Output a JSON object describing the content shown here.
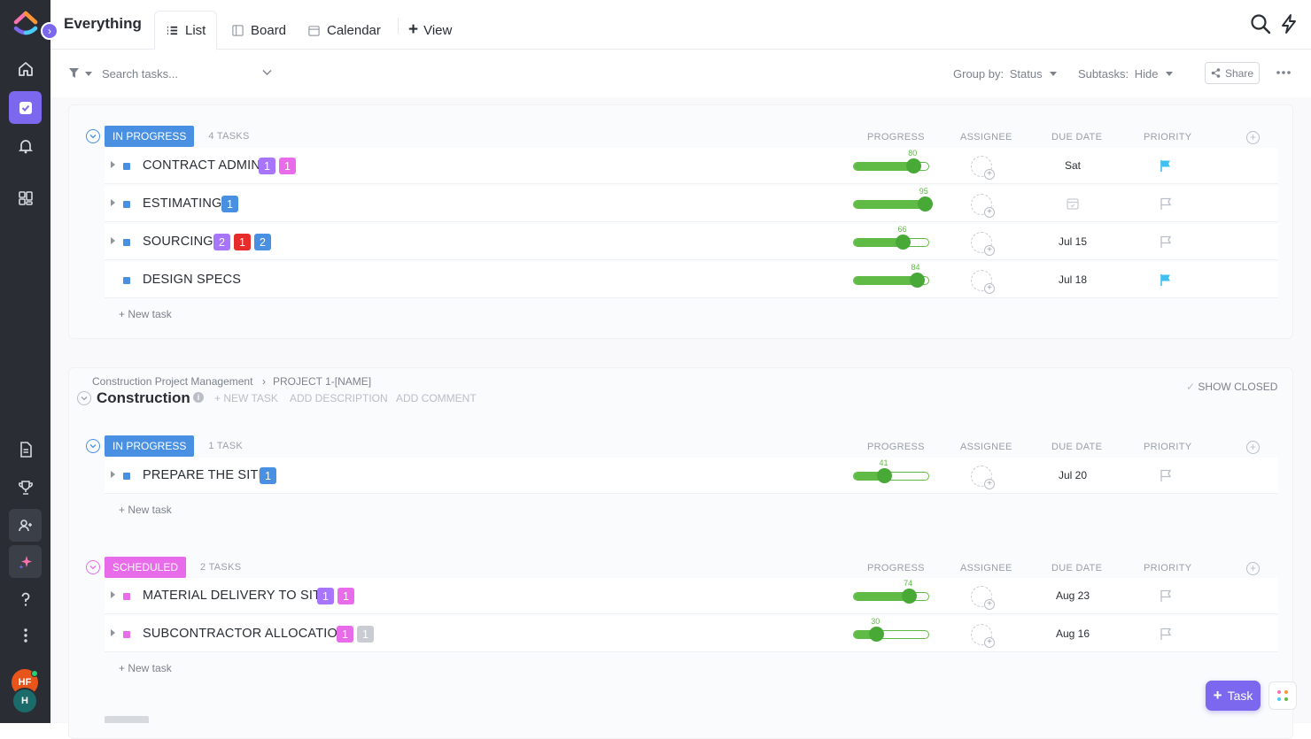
{
  "header": {
    "title": "Everything",
    "tabs": [
      {
        "label": "List"
      },
      {
        "label": "Board"
      },
      {
        "label": "Calendar"
      }
    ],
    "view_label": "View"
  },
  "toolbar": {
    "search_placeholder": "Search tasks...",
    "group_by_label": "Group by:",
    "group_by_value": "Status",
    "subtasks_label": "Subtasks:",
    "subtasks_value": "Hide",
    "share_label": "Share"
  },
  "columns": {
    "progress": "PROGRESS",
    "assignee": "ASSIGNEE",
    "due_date": "DUE DATE",
    "priority": "PRIORITY"
  },
  "new_task_label": "+ New task",
  "groups": [
    {
      "status": "IN PROGRESS",
      "status_color": "#4a90e2",
      "count": "4 TASKS",
      "tasks": [
        {
          "name": "CONTRACT ADMIN",
          "tags": [
            "1",
            "1"
          ],
          "progress": 80,
          "due": "Sat",
          "priority": "flagged"
        },
        {
          "name": "ESTIMATING",
          "tags": [
            "1"
          ],
          "progress": 95,
          "due": "",
          "priority": "none"
        },
        {
          "name": "SOURCING",
          "tags": [
            "2",
            "1",
            "2"
          ],
          "progress": 66,
          "due": "Jul 15",
          "priority": "none"
        },
        {
          "name": "DESIGN SPECS",
          "tags": [],
          "progress": 84,
          "due": "Jul 18",
          "priority": "flagged"
        }
      ]
    },
    {
      "status": "IN PROGRESS",
      "status_color": "#4a90e2",
      "count": "1 TASK",
      "tasks": [
        {
          "name": "PREPARE THE SITE",
          "tags": [
            "1"
          ],
          "progress": 41,
          "due": "Jul 20",
          "priority": "none"
        }
      ]
    },
    {
      "status": "SCHEDULED",
      "status_color": "#e86ce9",
      "count": "2 TASKS",
      "tasks": [
        {
          "name": "MATERIAL DELIVERY TO SITE",
          "tags": [
            "1",
            "1"
          ],
          "progress": 74,
          "due": "Aug 23",
          "priority": "none"
        },
        {
          "name": "SUBCONTRACTOR ALLOCATION",
          "tags": [
            "1",
            "1"
          ],
          "progress": 30,
          "due": "Aug 16",
          "priority": "none"
        }
      ]
    }
  ],
  "list": {
    "breadcrumb_space": "Construction Project Management",
    "breadcrumb_folder": "PROJECT 1-[NAME]",
    "name": "Construction",
    "new_task": "+ NEW TASK",
    "add_description": "ADD DESCRIPTION",
    "add_comment": "ADD COMMENT",
    "show_closed": "SHOW CLOSED"
  },
  "fab": {
    "label": "Task"
  },
  "avatars": [
    {
      "initials": "HF",
      "color": "#e8541a"
    },
    {
      "initials": "H",
      "color": "#1b6b6b"
    }
  ],
  "colors": {
    "accent": "#7b68ee",
    "progress": "#5fbb46",
    "flag_blue": "#3fc0f0"
  }
}
